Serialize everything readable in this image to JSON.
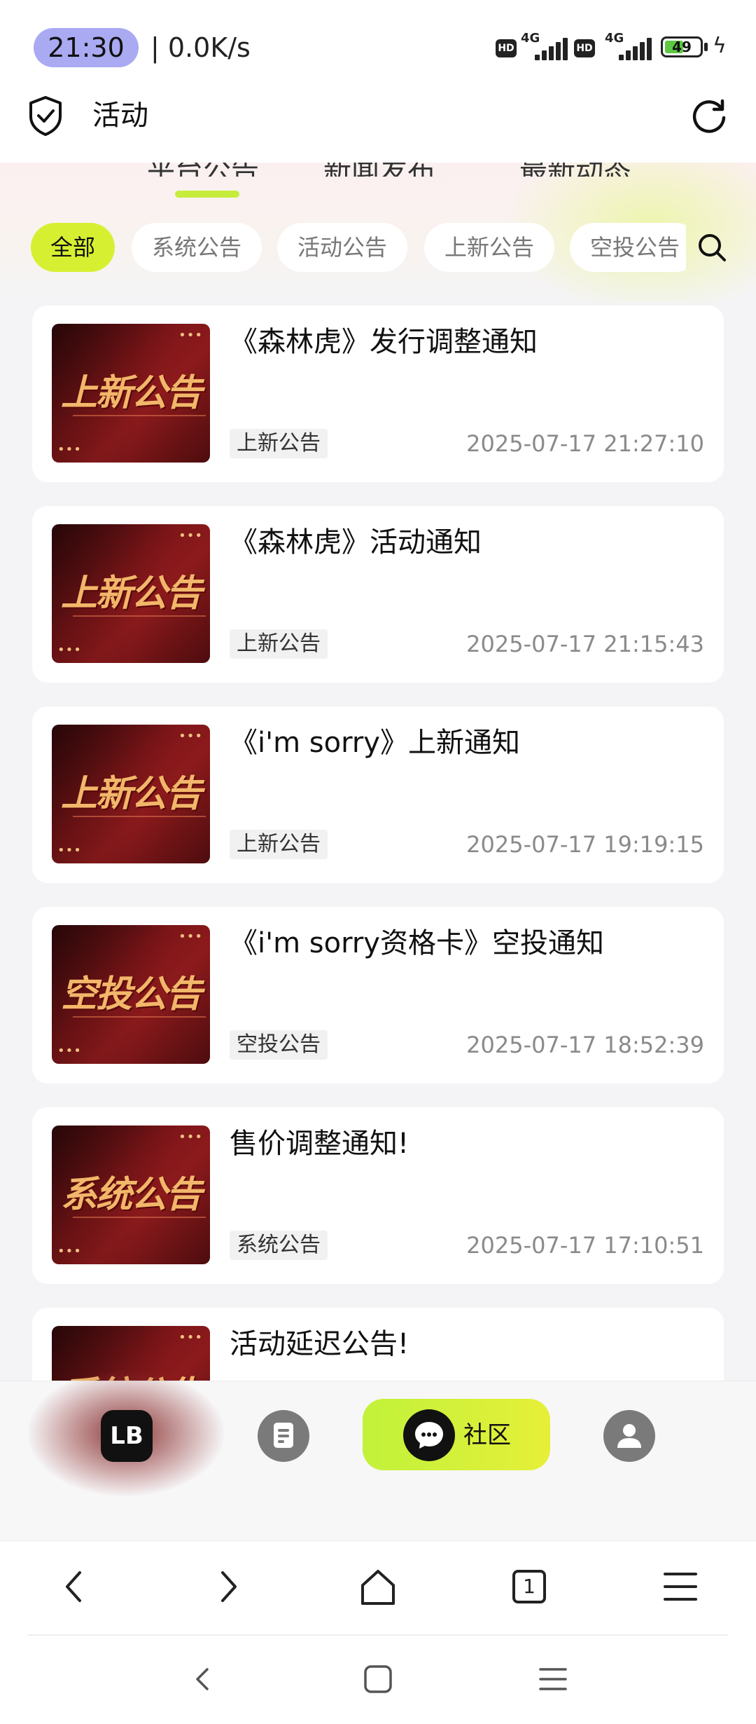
{
  "status_bar": {
    "time": "21:30",
    "net_speed": "| 0.0K/s",
    "battery": "49",
    "network_label": "4G",
    "hd_label": "HD"
  },
  "header": {
    "title": "活动"
  },
  "hero": {
    "tabs": [
      "平台公告",
      "新闻发布",
      "最新动态"
    ]
  },
  "filters": {
    "chips": [
      "全部",
      "系统公告",
      "活动公告",
      "上新公告",
      "空投公告"
    ],
    "active_index": 0
  },
  "announcements": [
    {
      "thumb_text": "上新公告",
      "title": "《森林虎》发行调整通知",
      "tag": "上新公告",
      "time": "2025-07-17 21:27:10"
    },
    {
      "thumb_text": "上新公告",
      "title": "《森林虎》活动通知",
      "tag": "上新公告",
      "time": "2025-07-17 21:15:43"
    },
    {
      "thumb_text": "上新公告",
      "title": "《i'm sorry》上新通知",
      "tag": "上新公告",
      "time": "2025-07-17 19:19:15"
    },
    {
      "thumb_text": "空投公告",
      "title": "《i'm sorry资格卡》空投通知",
      "tag": "空投公告",
      "time": "2025-07-17 18:52:39"
    },
    {
      "thumb_text": "系统公告",
      "title": "售价调整通知!",
      "tag": "系统公告",
      "time": "2025-07-17 17:10:51"
    },
    {
      "thumb_text": "系统公告",
      "title": "活动延迟公告!",
      "tag": "",
      "time": ""
    }
  ],
  "app_tabbar": {
    "home_label": "LB",
    "community_label": "社区"
  },
  "browser_nav": {
    "tab_count": "1"
  }
}
